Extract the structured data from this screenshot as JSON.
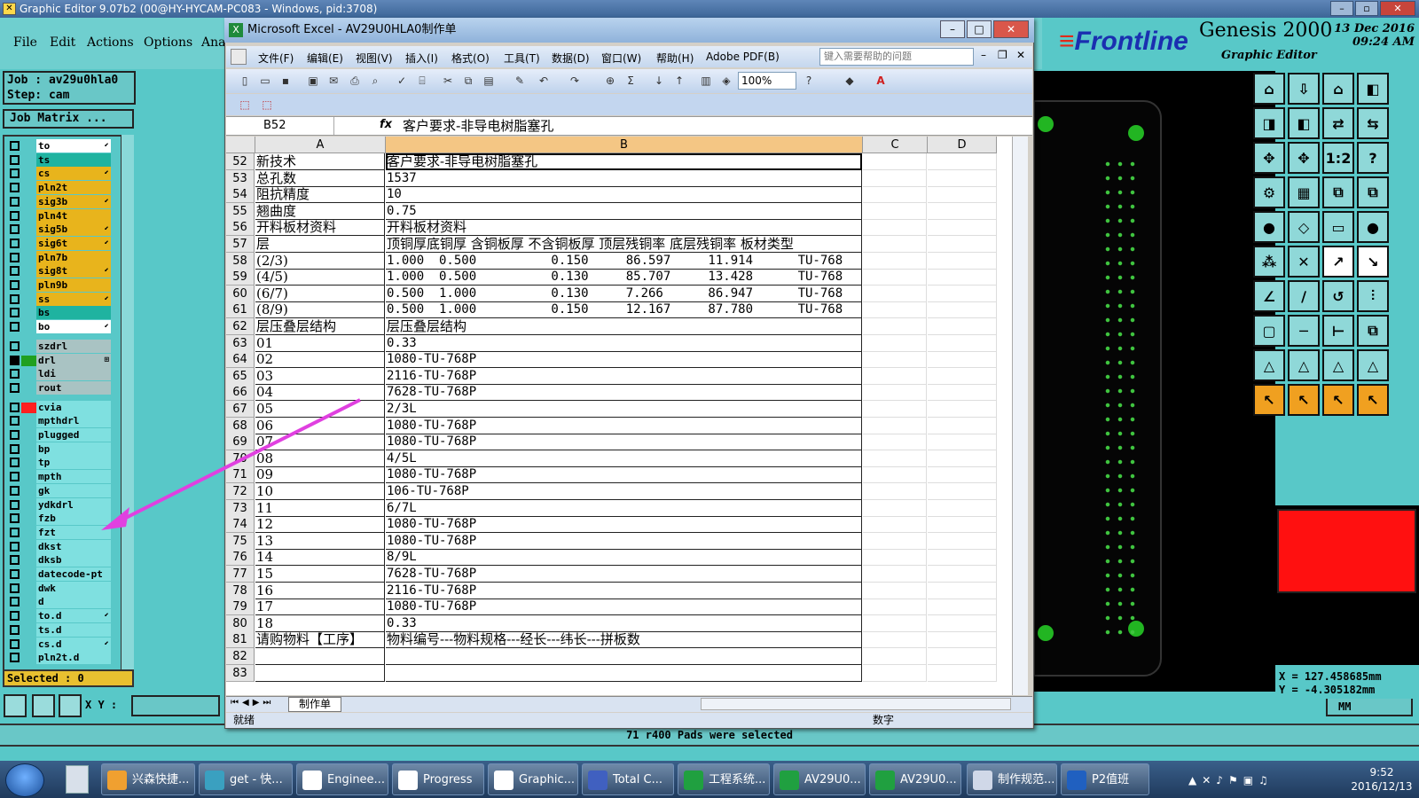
{
  "genesis": {
    "title": "Graphic Editor 9.07b2 (00@HY-HYCAM-PC083 - Windows, pid:3708)",
    "menus": [
      "File",
      "Edit",
      "Actions",
      "Options",
      "Ana"
    ],
    "job_line": "Job : av29u0hla0",
    "step_line": "Step: cam",
    "job_matrix": "Job Matrix ...",
    "selected": "Selected : 0",
    "xy_label": "X Y :",
    "status_message": "71 r400 Pads were selected",
    "units_button": "MM",
    "brand": "Frontline",
    "product": "Genesis 2000",
    "subtitle": "Graphic Editor",
    "date": "13 Dec 2016",
    "time": "09:24 AM",
    "coord_x": "X = 127.458685mm",
    "coord_y": "Y = -4.305182mm",
    "layers": [
      {
        "name": "to",
        "color": "#ffffff",
        "mark": "⬋"
      },
      {
        "name": "ts",
        "color": "#1fb3a0",
        "mark": ""
      },
      {
        "name": "cs",
        "color": "#e8b41c",
        "mark": "⬋"
      },
      {
        "name": "pln2t",
        "color": "#e8b41c",
        "mark": ""
      },
      {
        "name": "sig3b",
        "color": "#e8b41c",
        "mark": "⬋"
      },
      {
        "name": "pln4t",
        "color": "#e8b41c",
        "mark": ""
      },
      {
        "name": "sig5b",
        "color": "#e8b41c",
        "mark": "⬋"
      },
      {
        "name": "sig6t",
        "color": "#e8b41c",
        "mark": "⬋"
      },
      {
        "name": "pln7b",
        "color": "#e8b41c",
        "mark": ""
      },
      {
        "name": "sig8t",
        "color": "#e8b41c",
        "mark": "⬋"
      },
      {
        "name": "pln9b",
        "color": "#e8b41c",
        "mark": ""
      },
      {
        "name": "ss",
        "color": "#e8b41c",
        "mark": "⬋"
      },
      {
        "name": "bs",
        "color": "#1fb3a0",
        "mark": ""
      },
      {
        "name": "bo",
        "color": "#ffffff",
        "mark": "⬋"
      },
      {
        "name": "szdrl",
        "color": "#a9c3c3",
        "mark": ""
      },
      {
        "name": "drl",
        "color": "#a9c3c3",
        "mark": "⊞"
      },
      {
        "name": "ldi",
        "color": "#a9c3c3",
        "mark": ""
      },
      {
        "name": "rout",
        "color": "#a9c3c3",
        "mark": ""
      },
      {
        "name": "cvia",
        "color": "#7fe0e0",
        "mark": ""
      },
      {
        "name": "mpthdrl",
        "color": "#7fe0e0",
        "mark": ""
      },
      {
        "name": "plugged",
        "color": "#7fe0e0",
        "mark": ""
      },
      {
        "name": "bp",
        "color": "#7fe0e0",
        "mark": ""
      },
      {
        "name": "tp",
        "color": "#7fe0e0",
        "mark": ""
      },
      {
        "name": "mpth",
        "color": "#7fe0e0",
        "mark": ""
      },
      {
        "name": "gk",
        "color": "#7fe0e0",
        "mark": ""
      },
      {
        "name": "ydkdrl",
        "color": "#7fe0e0",
        "mark": ""
      },
      {
        "name": "fzb",
        "color": "#7fe0e0",
        "mark": ""
      },
      {
        "name": "fzt",
        "color": "#7fe0e0",
        "mark": ""
      },
      {
        "name": "dkst",
        "color": "#7fe0e0",
        "mark": ""
      },
      {
        "name": "dksb",
        "color": "#7fe0e0",
        "mark": ""
      },
      {
        "name": "datecode-pt",
        "color": "#7fe0e0",
        "mark": ""
      },
      {
        "name": "dwk",
        "color": "#7fe0e0",
        "mark": ""
      },
      {
        "name": "d",
        "color": "#7fe0e0",
        "mark": ""
      },
      {
        "name": "to.d",
        "color": "#7fe0e0",
        "mark": "⬋"
      },
      {
        "name": "ts.d",
        "color": "#7fe0e0",
        "mark": ""
      },
      {
        "name": "cs.d",
        "color": "#7fe0e0",
        "mark": "⬋"
      },
      {
        "name": "pln2t.d",
        "color": "#7fe0e0",
        "mark": ""
      }
    ]
  },
  "excel": {
    "title": "Microsoft Excel - AV29U0HLA0制作单",
    "menus": [
      "文件(F)",
      "编辑(E)",
      "视图(V)",
      "插入(I)",
      "格式(O)",
      "工具(T)",
      "数据(D)",
      "窗口(W)",
      "帮助(H)",
      "Adobe PDF(B)"
    ],
    "help_placeholder": "键入需要帮助的问题",
    "zoom": "100%",
    "name_box": "B52",
    "fx": "fx",
    "formula": "客户要求-非导电树脂塞孔",
    "columns": [
      "A",
      "B",
      "C",
      "D"
    ],
    "rows": [
      {
        "n": "52",
        "a": "新技术",
        "b": "客户要求-非导电树脂塞孔"
      },
      {
        "n": "53",
        "a": "总孔数",
        "b": "1537"
      },
      {
        "n": "54",
        "a": "阻抗精度",
        "b": "10"
      },
      {
        "n": "55",
        "a": "翘曲度",
        "b": "0.75"
      },
      {
        "n": "56",
        "a": "开料板材资料",
        "b": "开料板材资料"
      },
      {
        "n": "57",
        "a": "层",
        "b": "顶铜厚底铜厚 含铜板厚 不含铜板厚 顶层残铜率 底层残铜率 板材类型"
      },
      {
        "n": "58",
        "a": "(2/3)",
        "b": "1.000  0.500          0.150     86.597     11.914      TU-768"
      },
      {
        "n": "59",
        "a": "(4/5)",
        "b": "1.000  0.500          0.130     85.707     13.428      TU-768"
      },
      {
        "n": "60",
        "a": "(6/7)",
        "b": "0.500  1.000          0.130     7.266      86.947      TU-768"
      },
      {
        "n": "61",
        "a": "(8/9)",
        "b": "0.500  1.000          0.150     12.167     87.780      TU-768"
      },
      {
        "n": "62",
        "a": "层压叠层结构",
        "b": "层压叠层结构"
      },
      {
        "n": "63",
        "a": "01",
        "b": "0.33"
      },
      {
        "n": "64",
        "a": "02",
        "b": "1080-TU-768P"
      },
      {
        "n": "65",
        "a": "03",
        "b": "2116-TU-768P"
      },
      {
        "n": "66",
        "a": "04",
        "b": "7628-TU-768P"
      },
      {
        "n": "67",
        "a": "05",
        "b": "2/3L"
      },
      {
        "n": "68",
        "a": "06",
        "b": "1080-TU-768P"
      },
      {
        "n": "69",
        "a": "07",
        "b": "1080-TU-768P"
      },
      {
        "n": "70",
        "a": "08",
        "b": "4/5L"
      },
      {
        "n": "71",
        "a": "09",
        "b": "1080-TU-768P"
      },
      {
        "n": "72",
        "a": "10",
        "b": "106-TU-768P"
      },
      {
        "n": "73",
        "a": "11",
        "b": "6/7L"
      },
      {
        "n": "74",
        "a": "12",
        "b": "1080-TU-768P"
      },
      {
        "n": "75",
        "a": "13",
        "b": "1080-TU-768P"
      },
      {
        "n": "76",
        "a": "14",
        "b": "8/9L"
      },
      {
        "n": "77",
        "a": "15",
        "b": "7628-TU-768P"
      },
      {
        "n": "78",
        "a": "16",
        "b": "2116-TU-768P"
      },
      {
        "n": "79",
        "a": "17",
        "b": "1080-TU-768P"
      },
      {
        "n": "80",
        "a": "18",
        "b": "0.33"
      },
      {
        "n": "81",
        "a": "请购物料【工序】",
        "b": "物料编号---物料规格---经长---纬长---拼板数"
      },
      {
        "n": "82",
        "a": "",
        "b": ""
      },
      {
        "n": "83",
        "a": "",
        "b": ""
      }
    ],
    "sheet_tab": "制作单",
    "status": "就绪",
    "num_indicator": "数字"
  },
  "taskbar": {
    "items": [
      {
        "label": "兴森快捷...",
        "color": "#f0a030"
      },
      {
        "label": "get - 快...",
        "color": "#3aa0c0"
      },
      {
        "label": "Enginee...",
        "color": "#ffffff"
      },
      {
        "label": "Progress",
        "color": "#ffffff"
      },
      {
        "label": "Graphic...",
        "color": "#ffffff"
      },
      {
        "label": "Total C...",
        "color": "#4060c0"
      },
      {
        "label": "工程系统...",
        "color": "#20a040"
      },
      {
        "label": "AV29U0...",
        "color": "#20a040"
      },
      {
        "label": "AV29U0...",
        "color": "#20a040"
      },
      {
        "label": "制作规范...",
        "color": "#d0d8e8"
      },
      {
        "label": "P2值班",
        "color": "#2060c0"
      }
    ],
    "time": "9:52",
    "date": "2016/12/13"
  },
  "colors": {
    "accent_arrow": "#e040e0",
    "layer_bg": "#58c8c8",
    "selected_bg": "#e8c030"
  }
}
